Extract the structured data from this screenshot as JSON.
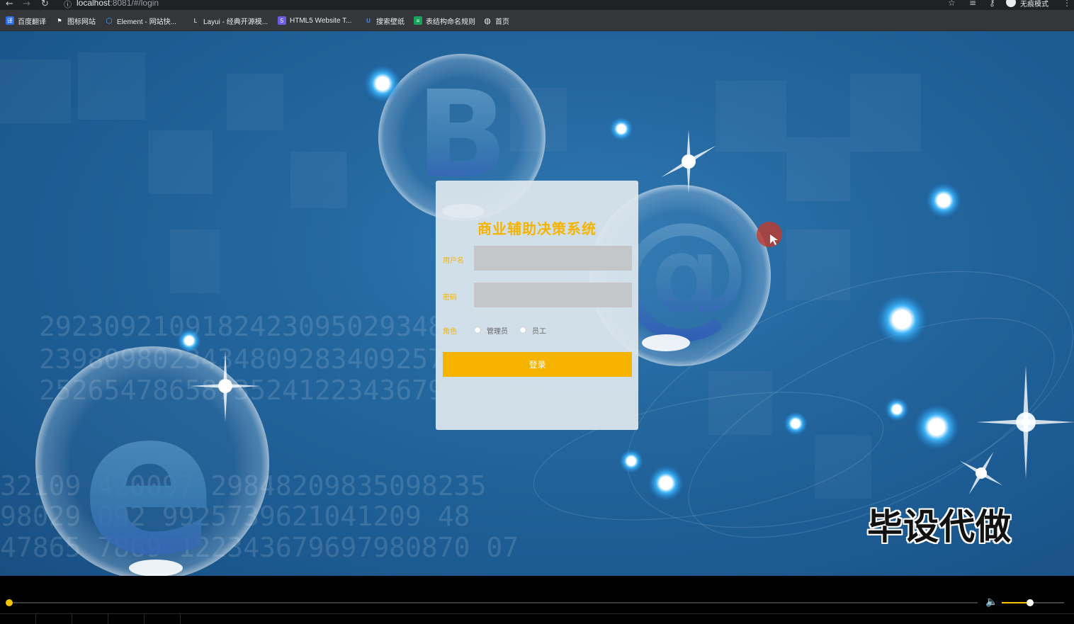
{
  "browser": {
    "url_host": "localhost",
    "url_rest": ":8081/#/login",
    "incognito_label": "无痕模式",
    "bookmarks": [
      {
        "label": "百度翻译",
        "icon": "baidu-translate-icon",
        "color": "#2b6de5"
      },
      {
        "label": "图标网站",
        "icon": "flag-icon",
        "color": "#444444"
      },
      {
        "label": "Element - 网站快...",
        "icon": "element-hexagon-icon",
        "color": "#409eff"
      },
      {
        "label": "Layui - 经典开源模...",
        "icon": "layui-icon",
        "color": "#35363a"
      },
      {
        "label": "HTML5 Website T...",
        "icon": "html5-template-icon",
        "color": "#6f5ce0"
      },
      {
        "label": "搜索壁纸",
        "icon": "wallpaper-search-icon",
        "color": "#2b6de5"
      },
      {
        "label": "表结构命名规则",
        "icon": "table-naming-icon",
        "color": "#19a35a"
      },
      {
        "label": "首页",
        "icon": "home-globe-icon",
        "color": "#5f6368"
      }
    ]
  },
  "login": {
    "title": "商业辅助决策系统",
    "username_label": "用户名",
    "username_value": "",
    "password_label": "密码",
    "password_value": "",
    "role_label": "角色",
    "roles": [
      "管理员",
      "员工"
    ],
    "submit_label": "登录"
  },
  "background_digits": [
    "2923092109182423095029348",
    "2398098023434809283409257",
    "2526547865873524122343679"
  ],
  "background_digits_lower": [
    "32109 420097 29848209835098235",
    "98029 092 9925739621041209 48",
    "47865 7869 122343679697980870 07"
  ],
  "bubble_letters": [
    "B",
    "@",
    "e"
  ],
  "watermark": "毕设代做",
  "player": {
    "progress_fraction": 0.0,
    "volume_fraction": 0.45
  },
  "colors": {
    "accent": "#f5b400",
    "page_bg": "#1f5f97",
    "card_bg": "#dee7ee"
  }
}
